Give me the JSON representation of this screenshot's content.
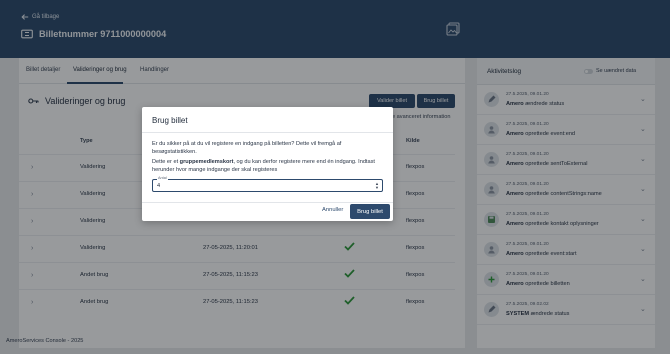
{
  "header": {
    "back_label": "Gå tilbage",
    "ticket_title": "Billetnummer 9711000000004"
  },
  "tabs": [
    {
      "label": "Billet detaljer"
    },
    {
      "label": "Valideringer og brug"
    },
    {
      "label": "Handlinger"
    }
  ],
  "section": {
    "title": "Valideringer og brug",
    "validate_button": "Valider billet",
    "use_button": "Brug billet",
    "advanced_info": "e avanceret information"
  },
  "table": {
    "columns": {
      "type": "Type",
      "source": "Kilde"
    },
    "rows": [
      {
        "type": "Validering",
        "date": "",
        "source": "flexpos"
      },
      {
        "type": "Validering",
        "date": "",
        "source": "flexpos"
      },
      {
        "type": "Validering",
        "date": "",
        "source": "flexpos"
      },
      {
        "type": "Validering",
        "date": "27-05-2025, 11:20:01",
        "source": "flexpos"
      },
      {
        "type": "Andet brug",
        "date": "27-05-2025, 11:15:23",
        "source": "flexpos"
      },
      {
        "type": "Andet brug",
        "date": "27-05-2025, 11:15:23",
        "source": "flexpos"
      }
    ]
  },
  "activity": {
    "title": "Aktivitetslog",
    "toggle_label": "Se uændret data",
    "entries": [
      {
        "time": "27.5.2025, 09.01.20",
        "actor": "Amero",
        "action": "ændrede status",
        "icon": "pencil-icon"
      },
      {
        "time": "27.5.2025, 09.01.20",
        "actor": "Amero",
        "action": "oprettede event:end",
        "icon": "user-icon"
      },
      {
        "time": "27.5.2025, 09.01.20",
        "actor": "Amero",
        "action": "oprettede sentToExternal",
        "icon": "user-icon"
      },
      {
        "time": "27.5.2025, 09.01.20",
        "actor": "Amero",
        "action": "oprettede contentStrings:name",
        "icon": "user-icon"
      },
      {
        "time": "27.5.2025, 09.01.20",
        "actor": "Amero",
        "action": "oprettede kontakt oplysninger",
        "icon": "save-icon"
      },
      {
        "time": "27.5.2025, 09.01.20",
        "actor": "Amero",
        "action": "oprettede event:start",
        "icon": "user-icon"
      },
      {
        "time": "27.5.2025, 09.01.20",
        "actor": "Amero",
        "action": "oprettede billetten",
        "icon": "plus-icon"
      },
      {
        "time": "27.5.2025, 09.02.02",
        "actor": "SYSTEM",
        "action": "ændrede status",
        "icon": "pencil-icon"
      }
    ]
  },
  "footer": "AmeroServices Console - 2025",
  "modal": {
    "title": "Brug billet",
    "text1": "Er du sikker på at du vil registere en indgang på billetten? Dette vil fremgå af besøgstatistikken.",
    "text2_pre": "Dette er et ",
    "text2_bold": "gruppemedlemskort",
    "text2_post": ", og du kan derfor registere mere end én indgang. Indtast herunder hvor mange indgange der skal registeres",
    "input_label": "Antal",
    "input_value": "4",
    "cancel_label": "Annuller",
    "confirm_label": "Brug billet"
  },
  "colors": {
    "primary": "#2d4a6d",
    "check_green": "#2f9a3c"
  }
}
